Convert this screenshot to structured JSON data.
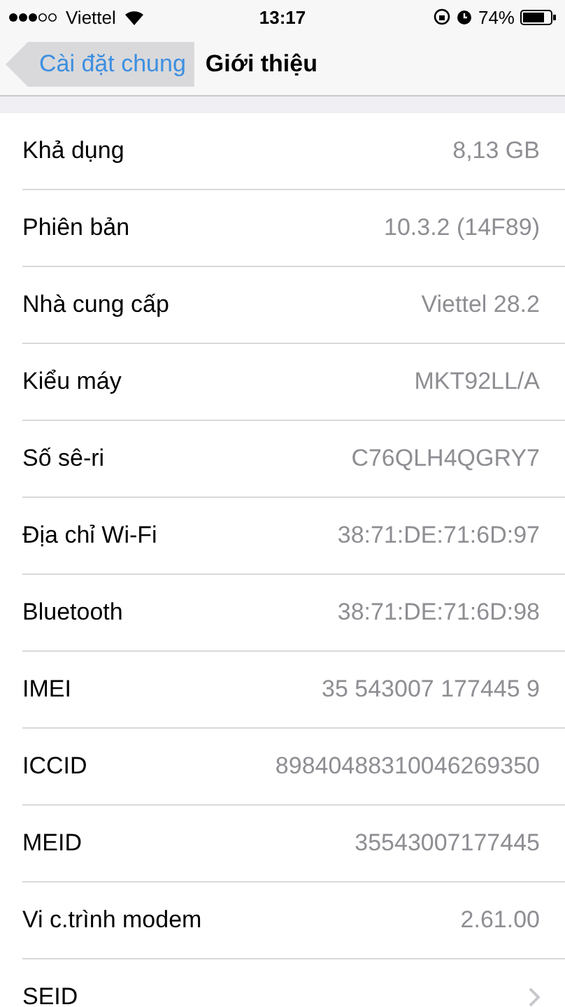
{
  "status_bar": {
    "carrier": "Viettel",
    "time": "13:17",
    "battery": "74%"
  },
  "nav": {
    "back": "Cài đặt chung",
    "title": "Giới thiệu"
  },
  "rows": [
    {
      "kind": "info",
      "label": "Khả dụng",
      "value": "8,13 GB"
    },
    {
      "kind": "info",
      "label": "Phiên bản",
      "value": "10.3.2 (14F89)"
    },
    {
      "kind": "info",
      "label": "Nhà cung cấp",
      "value": "Viettel 28.2"
    },
    {
      "kind": "info",
      "label": "Kiểu máy",
      "value": "MKT92LL/A"
    },
    {
      "kind": "info",
      "label": "Số sê-ri",
      "value": "C76QLH4QGRY7"
    },
    {
      "kind": "info",
      "label": "Địa chỉ Wi-Fi",
      "value": "38:71:DE:71:6D:97"
    },
    {
      "kind": "info",
      "label": "Bluetooth",
      "value": "38:71:DE:71:6D:98"
    },
    {
      "kind": "info",
      "label": "IMEI",
      "value": "35 543007 177445 9"
    },
    {
      "kind": "info",
      "label": "ICCID",
      "value": "89840488310046269350"
    },
    {
      "kind": "info",
      "label": "MEID",
      "value": "35543007177445"
    },
    {
      "kind": "info",
      "label": "Vi c.trình modem",
      "value": "2.61.00"
    },
    {
      "kind": "link",
      "label": "SEID"
    }
  ]
}
